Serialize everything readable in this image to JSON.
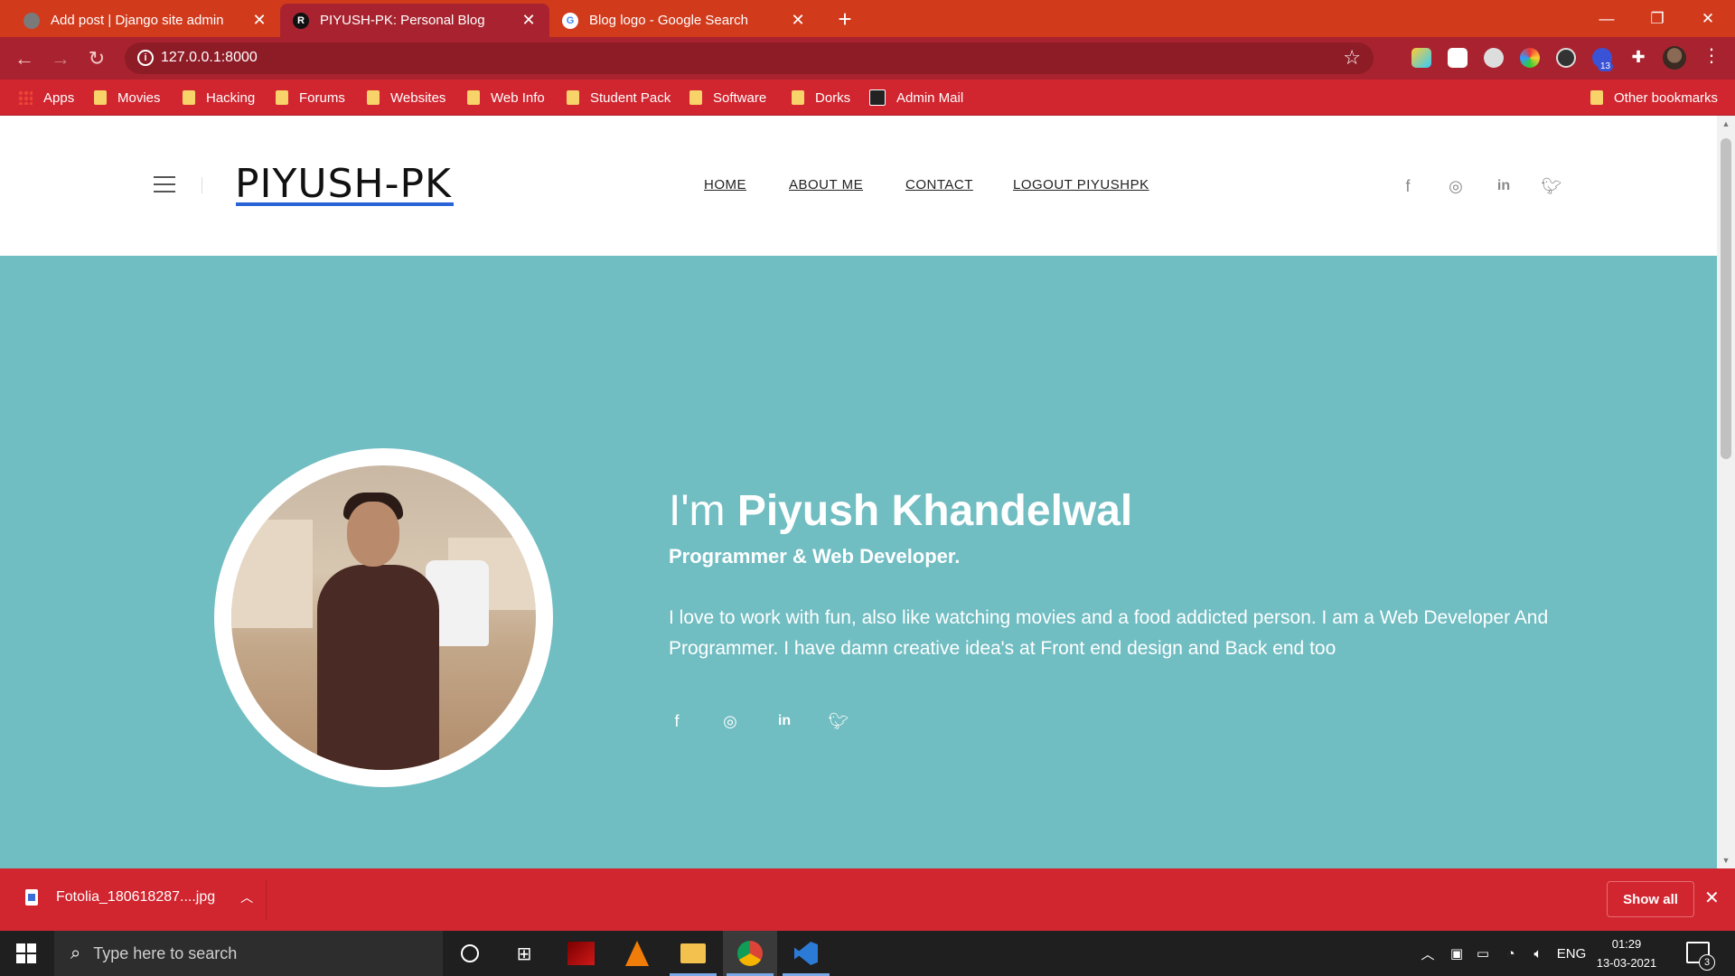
{
  "browser": {
    "tabs": [
      {
        "title": "Add post | Django site admin",
        "favicon": "django-icon"
      },
      {
        "title": "PIYUSH-PK: Personal Blog",
        "favicon": "blog-icon"
      },
      {
        "title": "Blog logo - Google Search",
        "favicon": "google-icon"
      }
    ],
    "new_tab": "+",
    "url": "127.0.0.1:8000",
    "extension_badge": "13",
    "bookmarks": [
      {
        "label": "Apps"
      },
      {
        "label": "Movies"
      },
      {
        "label": "Hacking"
      },
      {
        "label": "Forums"
      },
      {
        "label": "Websites"
      },
      {
        "label": "Web Info"
      },
      {
        "label": "Student Pack"
      },
      {
        "label": "Software"
      },
      {
        "label": "Dorks"
      },
      {
        "label": "Admin Mail"
      }
    ],
    "other_bookmarks": "Other bookmarks",
    "colors": {
      "tabbar": "#d23a1c",
      "toolbar": "#a8232f",
      "bookmarks": "#d1252f"
    }
  },
  "site": {
    "logo": "PIYUSH-PK",
    "nav": [
      {
        "label": "HOME"
      },
      {
        "label": "ABOUT ME"
      },
      {
        "label": "CONTACT"
      },
      {
        "label": "LOGOUT PIYUSHPK"
      }
    ],
    "social_icons": [
      "facebook-icon",
      "instagram-icon",
      "linkedin-icon",
      "twitter-icon"
    ],
    "hero": {
      "greeting": "I'm",
      "name": "Piyush Khandelwal",
      "subtitle": "Programmer & Web Developer.",
      "description": "I love to work with fun, also like watching movies and a food addicted person. I am a Web Developer And Programmer. I have damn creative idea's at Front end design and Back end too",
      "background_color": "#70bdc2"
    }
  },
  "downloads": {
    "file": "Fotolia_180618287....jpg",
    "show_all": "Show all"
  },
  "taskbar": {
    "search_placeholder": "Type here to search",
    "language": "ENG",
    "time": "01:29",
    "date": "13-03-2021",
    "notification_count": "3"
  }
}
